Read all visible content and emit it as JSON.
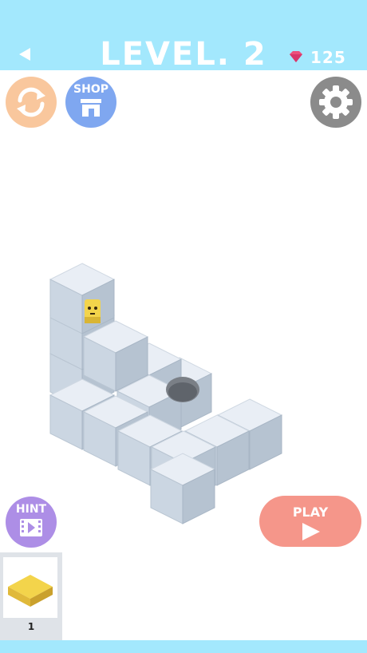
{
  "header": {
    "title": "LEVEL. 2",
    "gems": "125"
  },
  "buttons": {
    "shop_label": "SHOP",
    "hint_label": "HINT",
    "play_label": "PLAY"
  },
  "inventory": {
    "count": "1"
  },
  "colors": {
    "sky": "#a3e8fd",
    "restart": "#f9c79d",
    "shop": "#7fa7f0",
    "settings": "#8b8b8b",
    "hint": "#ad8ee6",
    "play": "#f5968a",
    "block": "#c7d3e0",
    "yellow": "#f3d44b"
  },
  "icons": [
    "back-arrow-icon",
    "gem-icon",
    "restart-icon",
    "shop-icon",
    "gear-icon",
    "video-icon",
    "play-triangle-icon",
    "yellow-tile-icon",
    "hole-icon",
    "character-icon"
  ]
}
